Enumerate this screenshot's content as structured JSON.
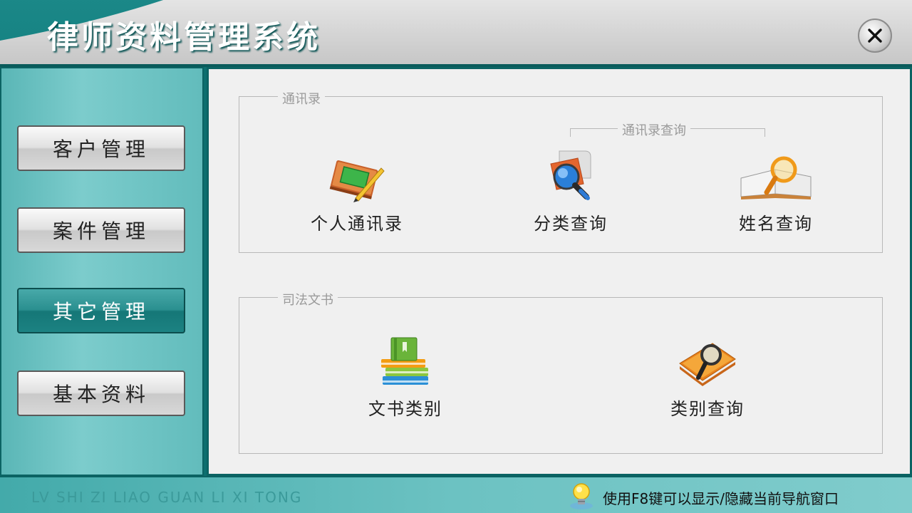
{
  "app": {
    "title": "律师资料管理系统",
    "close_icon": "close-icon"
  },
  "sidebar": {
    "items": [
      {
        "label": "客户管理",
        "active": false
      },
      {
        "label": "案件管理",
        "active": false
      },
      {
        "label": "其它管理",
        "active": true
      },
      {
        "label": "基本资料",
        "active": false
      }
    ]
  },
  "contacts_group": {
    "title": "通讯录",
    "subgroup_title": "通讯录查询",
    "items": [
      {
        "label": "个人通讯录",
        "icon": "notebook-pencil-icon"
      },
      {
        "label": "分类查询",
        "icon": "magnifier-scroll-icon"
      },
      {
        "label": "姓名查询",
        "icon": "book-magnifier-icon"
      }
    ]
  },
  "documents_group": {
    "title": "司法文书",
    "items": [
      {
        "label": "文书类别",
        "icon": "book-stack-icon"
      },
      {
        "label": "类别查询",
        "icon": "folder-magnifier-icon"
      }
    ]
  },
  "footer": {
    "pinyin": "LV SHI ZI LIAO GUAN LI XI TONG",
    "tip": "使用F8键可以显示/隐藏当前导航窗口",
    "tip_icon": "lightbulb-icon"
  },
  "colors": {
    "teal_dark": "#0b6363",
    "teal": "#148181",
    "panel_bg": "#f0f0f0"
  }
}
